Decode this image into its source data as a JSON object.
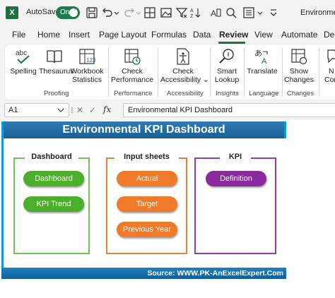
{
  "titlebar": {
    "app_logo": "X",
    "autosave_label": "AutoSave",
    "autosave_state": "On",
    "doc_title": "Environmen"
  },
  "menu": {
    "tabs": [
      "File",
      "Home",
      "Insert",
      "Page Layout",
      "Formulas",
      "Data",
      "Review",
      "View",
      "Automate",
      "De"
    ],
    "active": "Review"
  },
  "ribbon": {
    "spelling": "Spelling",
    "thesaurus": "Thesaurus",
    "workbook_stats_1": "Workbook",
    "workbook_stats_2": "Statistics",
    "proofing": "Proofing",
    "check_perf_1": "Check",
    "check_perf_2": "Performance",
    "performance": "Performance",
    "check_access_1": "Check",
    "check_access_2": "Accessibility",
    "access_arrow": "⌄",
    "accessibility": "Accessibility",
    "smart_1": "Smart",
    "smart_2": "Lookup",
    "insights": "Insights",
    "translate": "Translate",
    "language": "Language",
    "show_1": "Show",
    "show_2": "Changes",
    "changes": "Changes",
    "new_comment_1": "N",
    "new_comment_2": "Com"
  },
  "formula_bar": {
    "cell_ref": "A1",
    "fx": "fx",
    "cancel": "✕",
    "enter": "✓",
    "content": "Environmental KPI Dashboard"
  },
  "dashboard": {
    "title": "Environmental KPI Dashboard",
    "footer": "Source: WWW.PK-AnExcelExpert.Com",
    "panels": [
      {
        "title": "Dashboard",
        "buttons": [
          "Dashboard",
          "KPI Trend"
        ]
      },
      {
        "title": "Input sheets",
        "buttons": [
          "Actual",
          "Target",
          "Previous Year"
        ]
      },
      {
        "title": "KPI",
        "buttons": [
          "Definition"
        ]
      }
    ]
  },
  "colors": {
    "excel_green": "#1e7145",
    "panel_green": "#71c25a",
    "panel_orange": "#e8823b",
    "panel_purple": "#8e3fae",
    "pill_green": "#4caf2c",
    "pill_orange": "#ee7a2a",
    "pill_purple": "#8b2a9e",
    "banner_blue": "#1a5f96"
  }
}
